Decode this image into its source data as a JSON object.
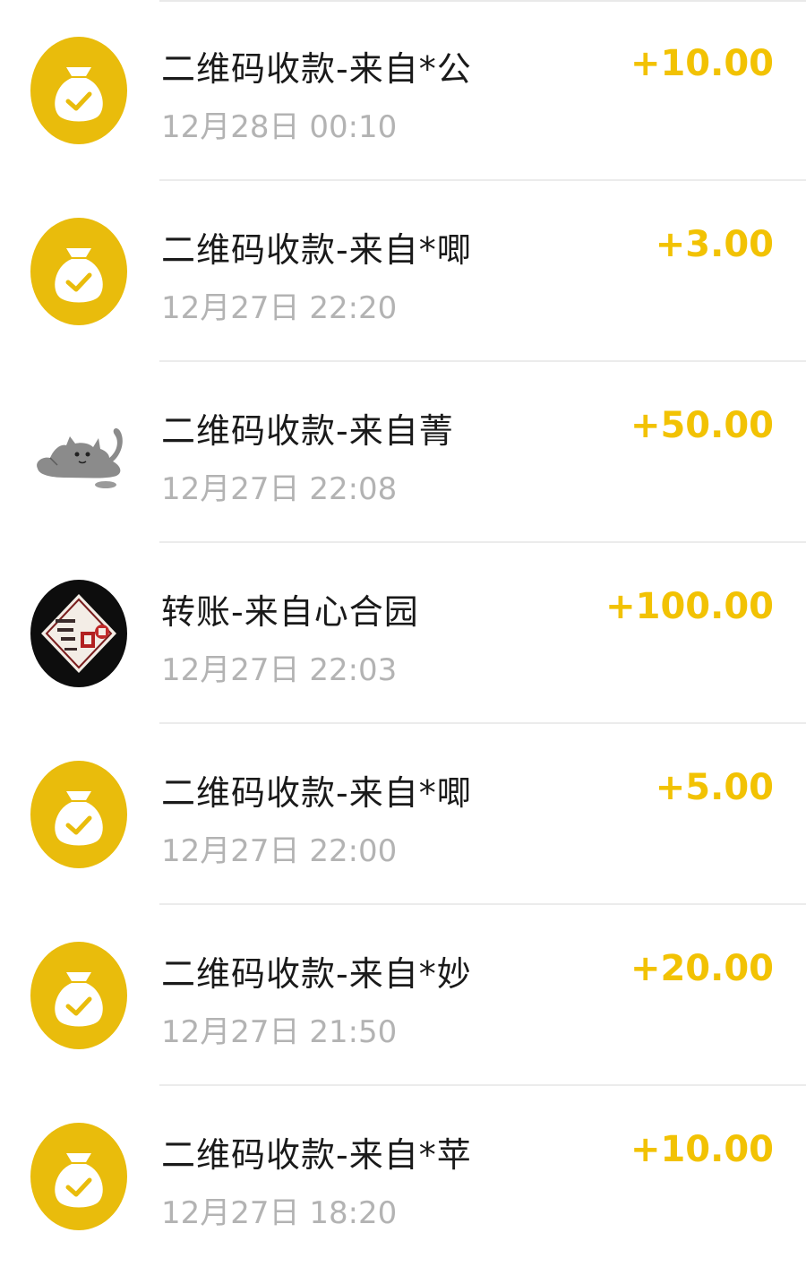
{
  "colors": {
    "accent_yellow": "#f2c203",
    "icon_yellow": "#e9bc0c",
    "title_text": "#1a1a1a",
    "time_text": "#b3b3b3",
    "divider": "#ececec"
  },
  "transactions": [
    {
      "icon": "money-bag-check-icon",
      "title": "二维码收款-来自*公",
      "time": "12月28日 00:10",
      "amount": "+10.00"
    },
    {
      "icon": "money-bag-check-icon",
      "title": "二维码收款-来自*唧",
      "time": "12月27日 22:20",
      "amount": "+3.00"
    },
    {
      "icon": "cat-avatar",
      "title": "二维码收款-来自菁",
      "time": "12月27日 22:08",
      "amount": "+50.00"
    },
    {
      "icon": "shop-logo-avatar",
      "title": "转账-来自心合园",
      "time": "12月27日 22:03",
      "amount": "+100.00"
    },
    {
      "icon": "money-bag-check-icon",
      "title": "二维码收款-来自*唧",
      "time": "12月27日 22:00",
      "amount": "+5.00"
    },
    {
      "icon": "money-bag-check-icon",
      "title": "二维码收款-来自*妙",
      "time": "12月27日 21:50",
      "amount": "+20.00"
    },
    {
      "icon": "money-bag-check-icon",
      "title": "二维码收款-来自*苹",
      "time": "12月27日 18:20",
      "amount": "+10.00"
    }
  ]
}
